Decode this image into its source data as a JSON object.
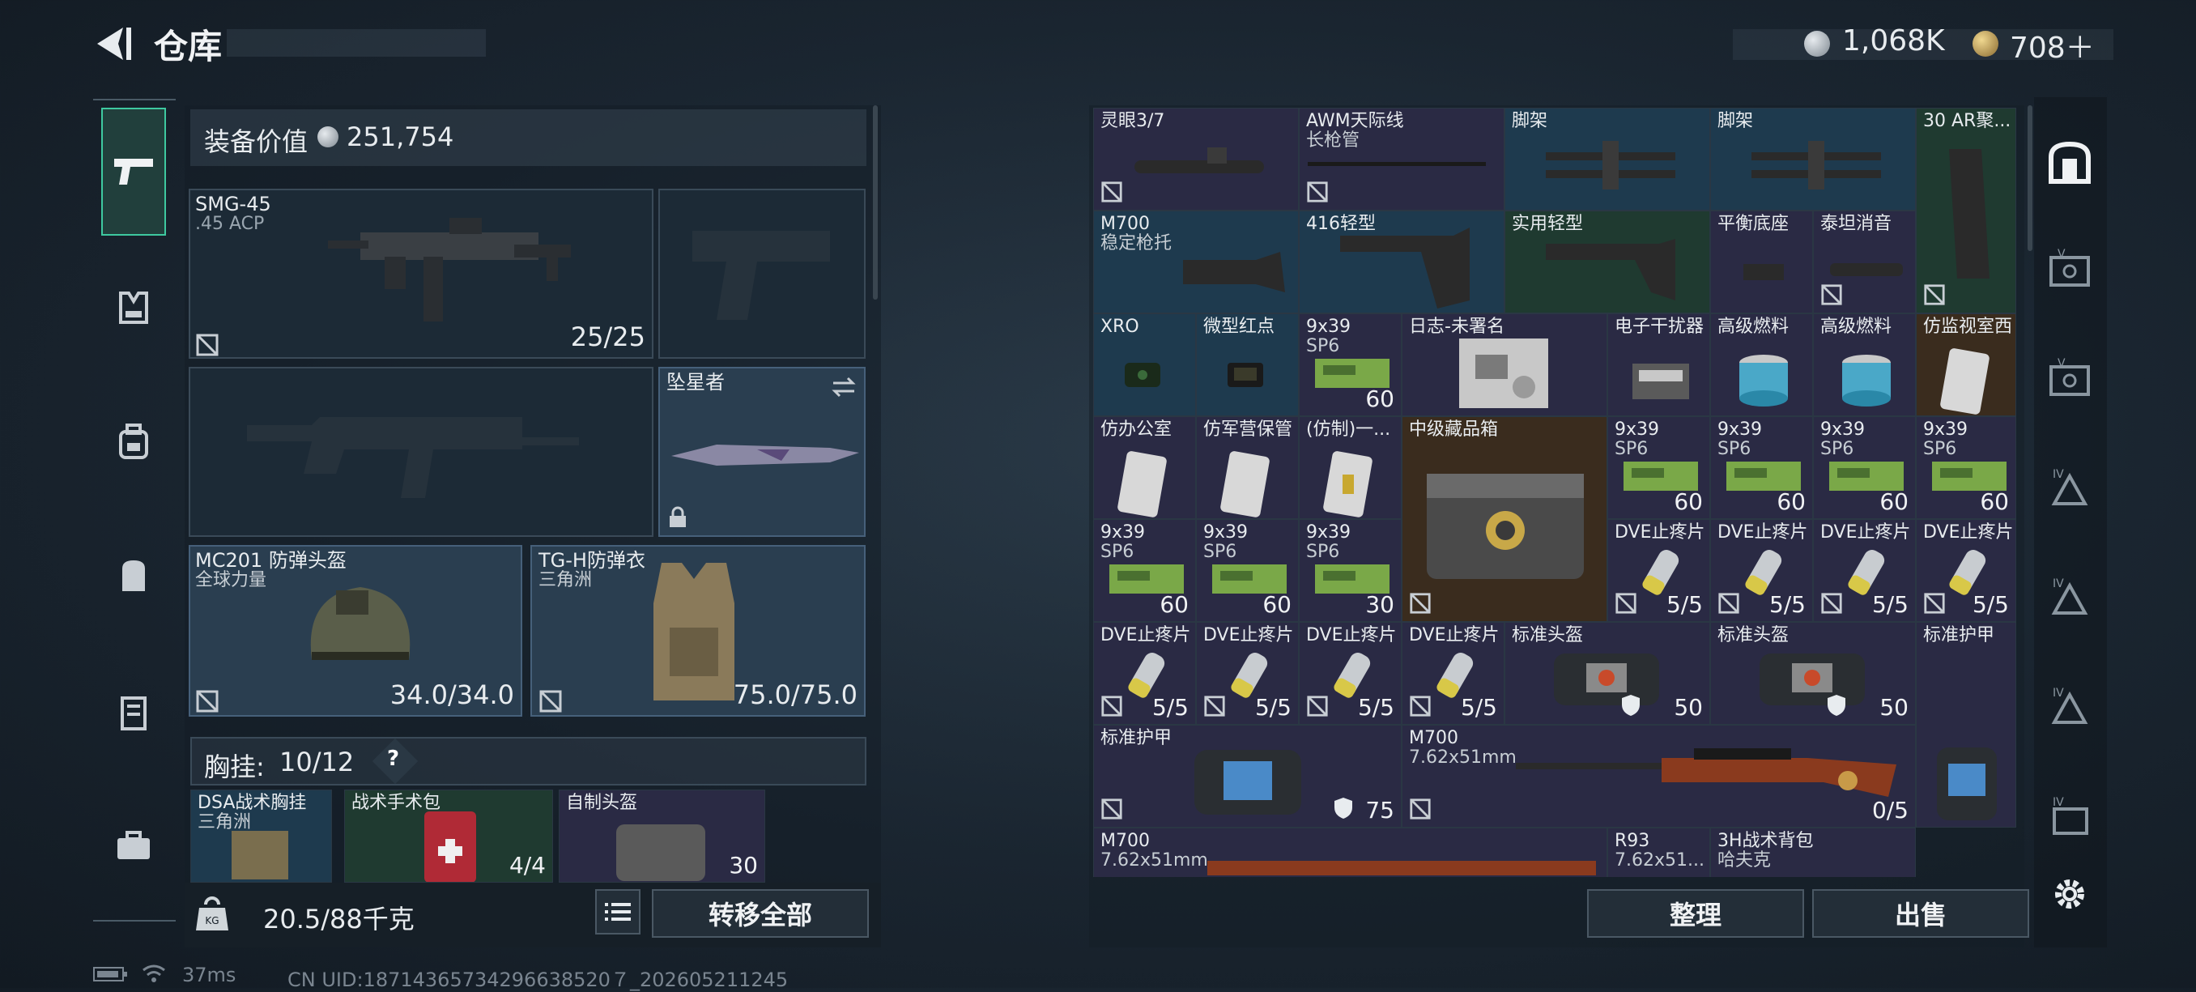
{
  "header": {
    "title": "仓库",
    "currency": [
      {
        "icon": "silver-coin-icon",
        "value": "1,068K"
      },
      {
        "icon": "gold-coin-icon",
        "value": "708＋"
      }
    ]
  },
  "left_nav": [
    "weapon-tab-icon",
    "armor-tab-icon",
    "bag-tab-icon",
    "backpack-tab-icon",
    "locker-tab-icon",
    "case-tab-icon"
  ],
  "equipment": {
    "value_label": "装备价值",
    "value": "251,754",
    "primary": {
      "name": "SMG-45",
      "sub": ".45 ACP",
      "count": "25/25"
    },
    "melee": {
      "name": "坠星者"
    },
    "helmet": {
      "name": "MC201 防弹头盔",
      "sub": "全球力量",
      "count": "34.0/34.0"
    },
    "armor": {
      "name": "TG-H防弹衣",
      "sub": "三角洲",
      "count": "75.0/75.0"
    },
    "chest": {
      "label": "胸挂:",
      "value": "10/12",
      "help": "?"
    },
    "chest_items": [
      {
        "name": "DSA战术胸挂",
        "sub": "三角洲"
      },
      {
        "name": "战术手术包",
        "count": "4/4"
      },
      {
        "name": "自制头盔",
        "count": "30"
      }
    ]
  },
  "bottom_left": {
    "weight": "20.5/88千克",
    "transfer_button": "转移全部"
  },
  "status": {
    "ping": "37ms",
    "uid": "CN UID:18714365734296638520７_202605211245"
  },
  "inventory": {
    "rows": [
      [
        {
          "name": "灵眼3/7",
          "color": "purple"
        },
        {
          "name": "AWM天际线",
          "sub": "长枪管",
          "color": "purple"
        },
        {
          "name": "脚架",
          "color": "blue"
        },
        {
          "name": "脚架",
          "color": "blue"
        },
        {
          "name": "30 AR聚...",
          "color": "green"
        }
      ],
      [
        {
          "name": "M700",
          "sub": "稳定枪托",
          "color": "blue"
        },
        {
          "name": "416轻型",
          "color": "blue"
        },
        {
          "name": "实用轻型",
          "color": "green"
        },
        {
          "name": "平衡底座",
          "color": "purple"
        },
        {
          "name": "泰坦消音",
          "color": "purple"
        }
      ],
      [
        {
          "name": "XRO",
          "color": "blue"
        },
        {
          "name": "微型红点",
          "color": "blue"
        },
        {
          "name": "9x39",
          "sub": "SP6",
          "count": "60",
          "color": "purple"
        },
        {
          "name": "日志-未署名",
          "color": "purple"
        },
        {
          "name": "电子干扰器",
          "color": "purple"
        },
        {
          "name": "高级燃料",
          "color": "purple"
        },
        {
          "name": "高级燃料",
          "color": "purple"
        },
        {
          "name": "仿监视室西",
          "color": "gold"
        }
      ],
      [
        {
          "name": "仿办公室",
          "color": "purple"
        },
        {
          "name": "仿军营保管",
          "color": "purple"
        },
        {
          "name": "(仿制)一...",
          "color": "purple"
        },
        {
          "name": "中级藏品箱",
          "color": "gold"
        },
        {
          "name": "9x39",
          "sub": "SP6",
          "count": "60",
          "color": "purple"
        },
        {
          "name": "9x39",
          "sub": "SP6",
          "count": "60",
          "color": "purple"
        },
        {
          "name": "9x39",
          "sub": "SP6",
          "count": "60",
          "color": "purple"
        },
        {
          "name": "9x39",
          "sub": "SP6",
          "count": "60",
          "color": "purple"
        }
      ],
      [
        {
          "name": "9x39",
          "sub": "SP6",
          "count": "60",
          "color": "purple"
        },
        {
          "name": "9x39",
          "sub": "SP6",
          "count": "60",
          "color": "purple"
        },
        {
          "name": "9x39",
          "sub": "SP6",
          "count": "30",
          "color": "purple"
        },
        {
          "name": "DVE止疼片",
          "count": "5/5",
          "color": "purple"
        },
        {
          "name": "DVE止疼片",
          "count": "5/5",
          "color": "purple"
        },
        {
          "name": "DVE止疼片",
          "count": "5/5",
          "color": "purple"
        },
        {
          "name": "DVE止疼片",
          "count": "5/5",
          "color": "purple"
        }
      ],
      [
        {
          "name": "DVE止疼片",
          "count": "5/5",
          "color": "purple"
        },
        {
          "name": "DVE止疼片",
          "count": "5/5",
          "color": "purple"
        },
        {
          "name": "DVE止疼片",
          "count": "5/5",
          "color": "purple"
        },
        {
          "name": "DVE止疼片",
          "count": "5/5",
          "color": "purple"
        },
        {
          "name": "标准头盔",
          "count": "50",
          "color": "purple"
        },
        {
          "name": "标准头盔",
          "count": "50",
          "color": "purple"
        },
        {
          "name": "标准护甲",
          "color": "purple"
        }
      ],
      [
        {
          "name": "标准护甲",
          "count": "75",
          "color": "purple"
        },
        {
          "name": "M700",
          "sub": "7.62x51mm",
          "count": "0/5",
          "color": "purple"
        }
      ],
      [
        {
          "name": "M700",
          "sub": "7.62x51mm",
          "color": "purple"
        },
        {
          "name": "R93",
          "sub": "7.62x51...",
          "color": "purple"
        },
        {
          "name": "3H战术背包",
          "sub": "哈夫克",
          "color": "purple"
        }
      ]
    ],
    "sort_button": "整理",
    "sell_button": "出售"
  },
  "right_nav": [
    "safe-box-icon",
    "case-v-icon",
    "case-v-icon-2",
    "case-iv-icon",
    "case-iv-icon-2",
    "case-iv-icon-3",
    "case-iv-icon-4",
    "settings-icon"
  ]
}
